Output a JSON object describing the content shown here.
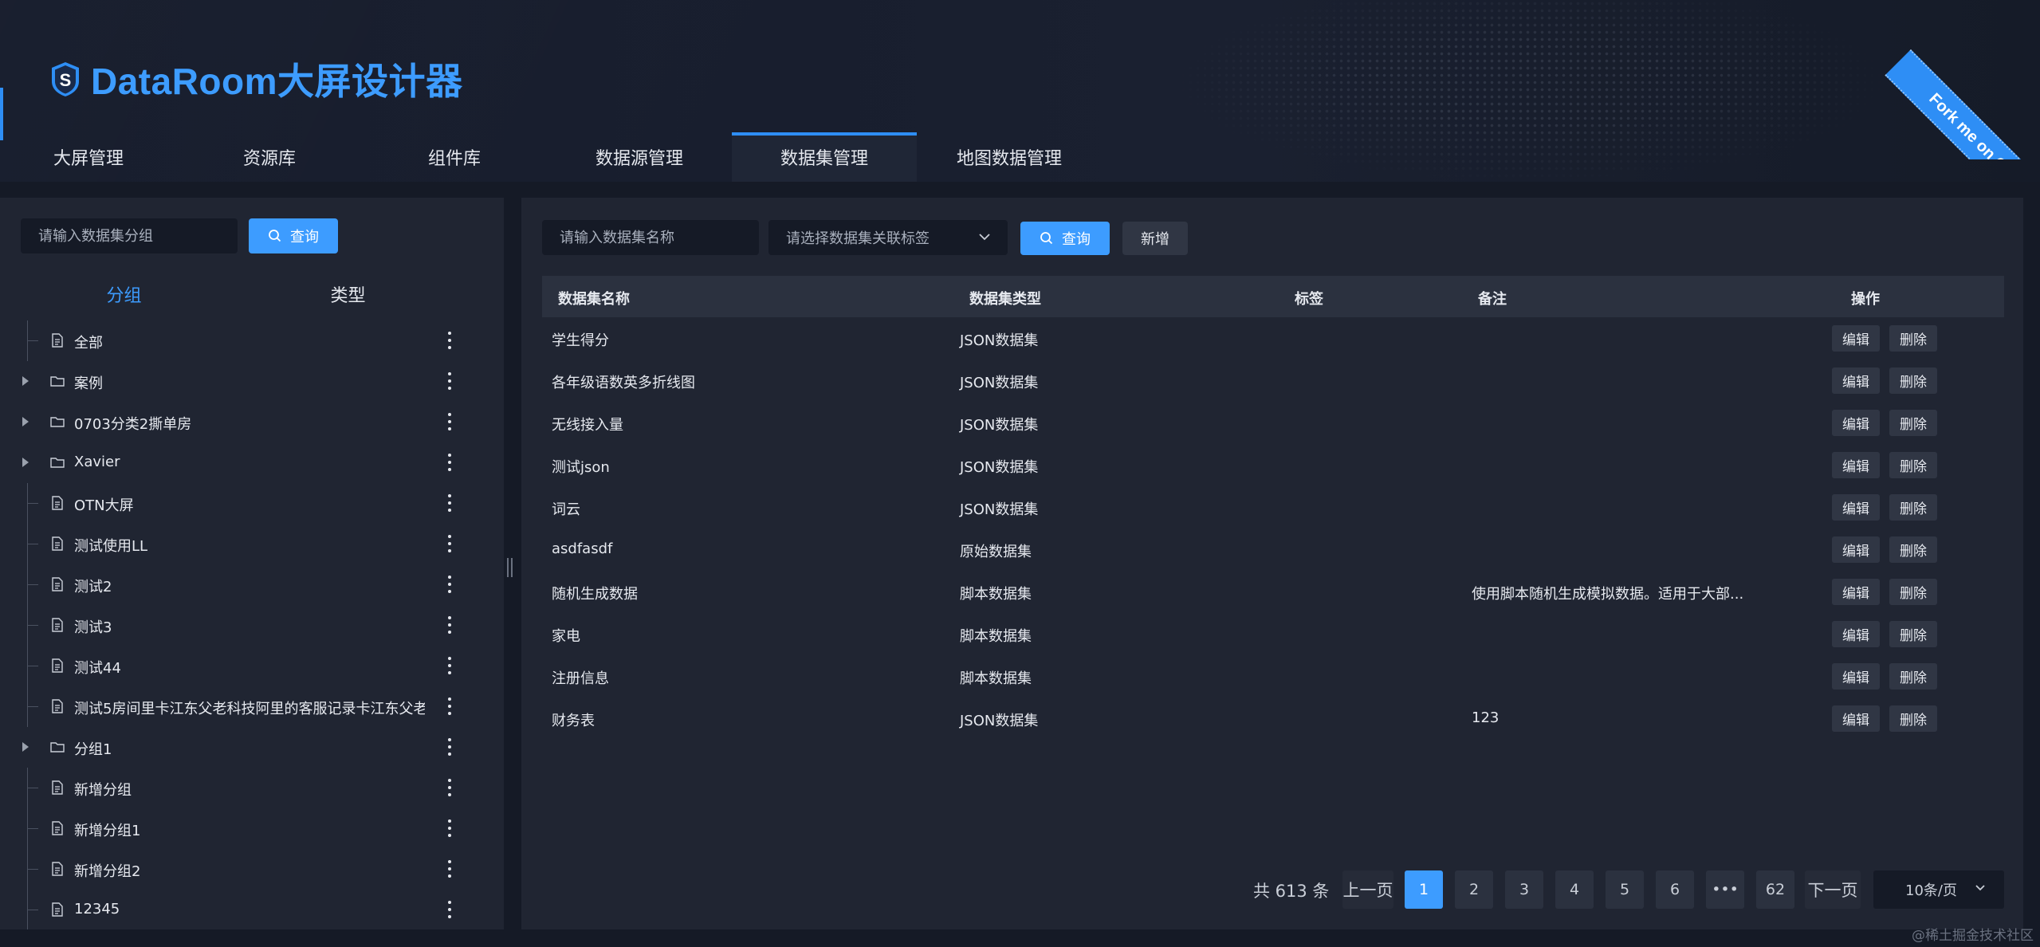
{
  "app": {
    "title": "DataRoom大屏设计器",
    "ribbon_text": "Fork me on GitHub",
    "accent_color": "#3d9cff"
  },
  "nav": {
    "items": [
      {
        "label": "大屏管理",
        "active": false
      },
      {
        "label": "资源库",
        "active": false
      },
      {
        "label": "组件库",
        "active": false
      },
      {
        "label": "数据源管理",
        "active": false
      },
      {
        "label": "数据集管理",
        "active": true
      },
      {
        "label": "地图数据管理",
        "active": false
      }
    ]
  },
  "left": {
    "search_placeholder": "请输入数据集分组",
    "query_label": "查询",
    "tabs": [
      "分组",
      "类型"
    ],
    "tree": [
      {
        "label": "全部",
        "type": "file",
        "expandable": false
      },
      {
        "label": "案例",
        "type": "folder",
        "expandable": true
      },
      {
        "label": "0703分类2撕单房",
        "type": "folder",
        "expandable": true
      },
      {
        "label": "Xavier",
        "type": "folder",
        "expandable": true
      },
      {
        "label": "OTN大屏",
        "type": "file",
        "expandable": false
      },
      {
        "label": "测试使用LL",
        "type": "file",
        "expandable": false
      },
      {
        "label": "测试2",
        "type": "file",
        "expandable": false
      },
      {
        "label": "测试3",
        "type": "file",
        "expandable": false
      },
      {
        "label": "测试44",
        "type": "file",
        "expandable": false
      },
      {
        "label": "测试5房间里卡江东父老科技阿里的客服记录卡江东父老",
        "type": "file",
        "expandable": false
      },
      {
        "label": "分组1",
        "type": "folder",
        "expandable": true
      },
      {
        "label": "新增分组",
        "type": "file",
        "expandable": false
      },
      {
        "label": "新增分组1",
        "type": "file",
        "expandable": false
      },
      {
        "label": "新增分组2",
        "type": "file",
        "expandable": false
      },
      {
        "label": "12345",
        "type": "file",
        "expandable": false
      }
    ]
  },
  "right": {
    "name_placeholder": "请输入数据集名称",
    "tag_placeholder": "请选择数据集关联标签",
    "query_label": "查询",
    "add_label": "新增",
    "columns": [
      "数据集名称",
      "数据集类型",
      "标签",
      "备注",
      "操作"
    ],
    "rows": [
      {
        "name": "学生得分",
        "type": "JSON数据集",
        "tag": "",
        "remark": ""
      },
      {
        "name": "各年级语数英多折线图",
        "type": "JSON数据集",
        "tag": "",
        "remark": ""
      },
      {
        "name": "无线接入量",
        "type": "JSON数据集",
        "tag": "",
        "remark": ""
      },
      {
        "name": "测试json",
        "type": "JSON数据集",
        "tag": "",
        "remark": ""
      },
      {
        "name": "词云",
        "type": "JSON数据集",
        "tag": "",
        "remark": ""
      },
      {
        "name": "asdfasdf",
        "type": "原始数据集",
        "tag": "",
        "remark": ""
      },
      {
        "name": "随机生成数据",
        "type": "脚本数据集",
        "tag": "",
        "remark": "使用脚本随机生成模拟数据。适用于大部..."
      },
      {
        "name": "家电",
        "type": "脚本数据集",
        "tag": "",
        "remark": ""
      },
      {
        "name": "注册信息",
        "type": "脚本数据集",
        "tag": "",
        "remark": ""
      },
      {
        "name": "财务表",
        "type": "JSON数据集",
        "tag": "",
        "remark": "123"
      }
    ],
    "edit_label": "编辑",
    "delete_label": "删除"
  },
  "pager": {
    "total_text": "共 613 条",
    "prev_label": "上一页",
    "next_label": "下一页",
    "pages": [
      "1",
      "2",
      "3",
      "4",
      "5",
      "6",
      "•••",
      "62"
    ],
    "current_page": "1",
    "page_size": "10条/页"
  },
  "watermark": "@稀土掘金技术社区"
}
